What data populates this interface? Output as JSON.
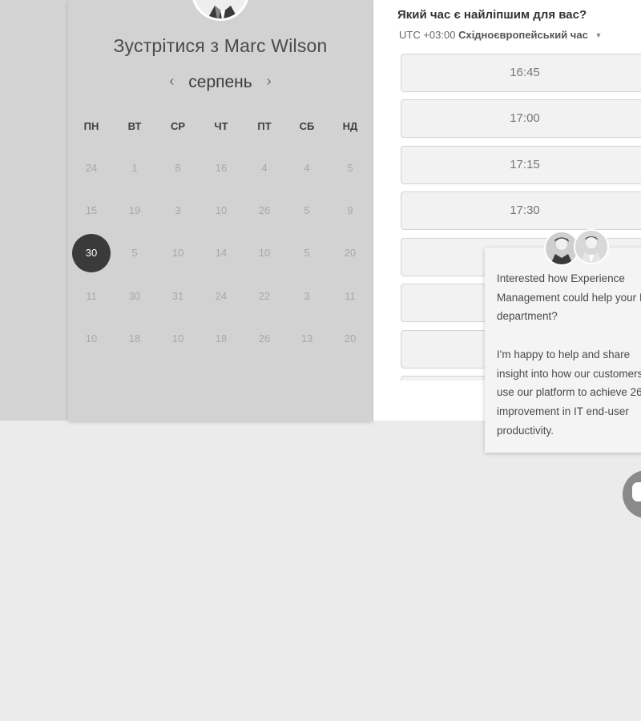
{
  "meeting": {
    "title": "Зустрітися з Marc Wilson"
  },
  "calendar": {
    "month": "серпень",
    "prev_icon": "chevron-left-icon",
    "next_icon": "chevron-right-icon",
    "weekdays": [
      "ПН",
      "ВТ",
      "СР",
      "ЧТ",
      "ПТ",
      "СБ",
      "НД"
    ],
    "weeks": [
      [
        "24",
        "1",
        "8",
        "16",
        "4",
        "4",
        "5"
      ],
      [
        "15",
        "19",
        "3",
        "10",
        "26",
        "5",
        "9"
      ],
      [
        "30",
        "5",
        "10",
        "14",
        "10",
        "5",
        "20"
      ],
      [
        "11",
        "30",
        "31",
        "24",
        "22",
        "3",
        "11"
      ],
      [
        "10",
        "18",
        "10",
        "18",
        "26",
        "13",
        "20"
      ]
    ],
    "selected_day": "30"
  },
  "scheduler": {
    "question": "Який час є найліпшим для вас?",
    "tz_offset": "UTC +03:00",
    "tz_name": "Східноєвропейський час",
    "slots": [
      "16:45",
      "17:00",
      "17:15",
      "17:30",
      "",
      "",
      "",
      ""
    ]
  },
  "chat": {
    "message": "Interested how Experience\nManagement could help your I\ndepartment?\n\nI'm happy to help and share\ninsight into how our customers\nuse our platform to achieve 26\nimprovement in IT end-user\nproductivity.",
    "launcher_icon": "chat-bubble-icon"
  },
  "colors": {
    "selected_day": "#3a3a3a",
    "panel_bg": "#d2d2d2",
    "page_bg": "#ebebeb"
  }
}
